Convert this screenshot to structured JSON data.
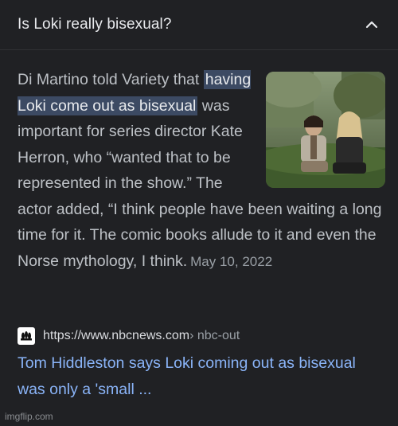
{
  "question": {
    "text": "Is Loki really bisexual?",
    "icon": "chevron-up-icon"
  },
  "snippet": {
    "text_before": "Di Martino told Variety that ",
    "highlight": "having Loki come out as bisexual",
    "text_after": " was important for series director Kate Herron, who “wanted that to be represented in the show.” The actor added, “I think people have been waiting a long time for it. The comic books allude to it and even the Norse mythology, I think.",
    "date": "May 10, 2022"
  },
  "source": {
    "favicon": "nbc-peacock-icon",
    "url": "https://www.nbcnews.com",
    "path": " › nbc-out"
  },
  "result": {
    "title": "Tom Hiddleston says Loki coming out as bisexual was only a 'small ..."
  },
  "watermark": "imgflip.com",
  "colors": {
    "background": "#202124",
    "link": "#8ab4f8",
    "highlight": "#3c4a63",
    "text": "#bdc1c6"
  }
}
